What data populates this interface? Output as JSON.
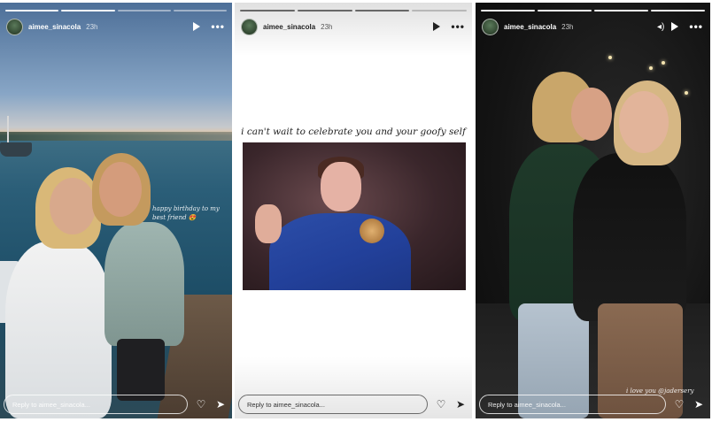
{
  "stories": [
    {
      "username": "aimee_sinacola",
      "time": "23h",
      "overlay_text": "happy birthday to my best friend 😍",
      "reply_placeholder": "Reply to aimee_sinacola..."
    },
    {
      "username": "aimee_sinacola",
      "time": "23h",
      "caption": "i can't wait to celebrate you and your goofy self",
      "reply_placeholder": "Reply to aimee_sinacola..."
    },
    {
      "username": "aimee_sinacola",
      "time": "23h",
      "overlay_text": "i love you @jadersery",
      "reply_placeholder": "Reply to aimee_sinacola..."
    }
  ],
  "icons": {
    "play": "play-icon",
    "more": "more-icon",
    "heart": "heart-icon",
    "send": "send-icon",
    "mute": "mute-icon"
  },
  "colors": {
    "panel_bg_dark": "#151515",
    "panel_bg_light": "#ffffff",
    "text_light": "#ffffff"
  }
}
